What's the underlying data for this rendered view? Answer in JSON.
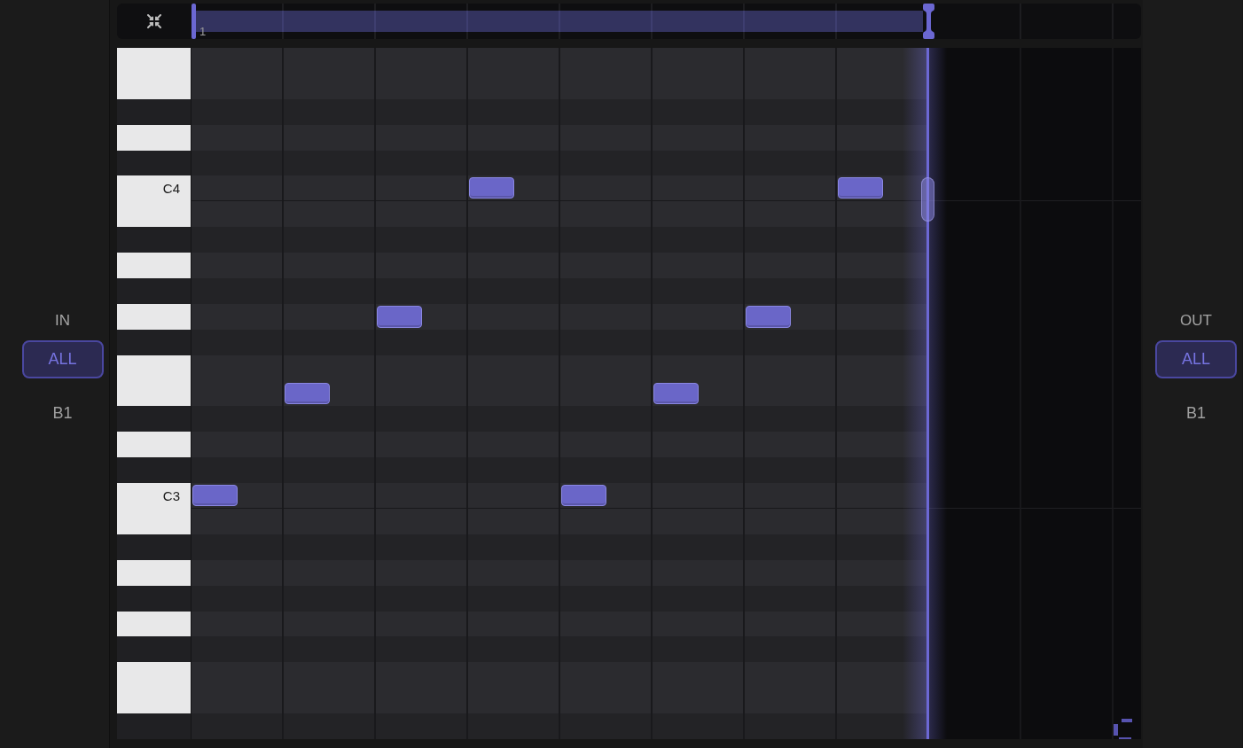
{
  "input": {
    "title": "IN",
    "channel_button": "ALL",
    "note": "B1"
  },
  "ruler": {
    "bar_labels": [
      "1"
    ]
  },
  "piano_roll": {
    "rows": [
      {
        "kind": "white",
        "steps": [
          false,
          false,
          false,
          false,
          false,
          false,
          false,
          false
        ]
      },
      {
        "kind": "white",
        "steps": [
          false,
          false,
          false,
          false,
          false,
          false,
          false,
          false
        ]
      },
      {
        "kind": "black",
        "steps": [
          false,
          false,
          false,
          false,
          false,
          false,
          false,
          false
        ]
      },
      {
        "kind": "white",
        "steps": [
          false,
          false,
          false,
          false,
          false,
          false,
          false,
          false
        ]
      },
      {
        "kind": "black",
        "steps": [
          false,
          false,
          false,
          false,
          false,
          false,
          false,
          false
        ]
      },
      {
        "kind": "white",
        "label": "C4",
        "steps": [
          false,
          false,
          false,
          true,
          false,
          false,
          false,
          true
        ]
      },
      {
        "kind": "white",
        "steps": [
          false,
          false,
          false,
          false,
          false,
          false,
          false,
          false
        ]
      },
      {
        "kind": "black",
        "steps": [
          false,
          false,
          false,
          false,
          false,
          false,
          false,
          false
        ]
      },
      {
        "kind": "white",
        "steps": [
          false,
          false,
          false,
          false,
          false,
          false,
          false,
          false
        ]
      },
      {
        "kind": "black",
        "steps": [
          false,
          false,
          false,
          false,
          false,
          false,
          false,
          false
        ]
      },
      {
        "kind": "white",
        "steps": [
          false,
          false,
          true,
          false,
          false,
          false,
          true,
          false
        ]
      },
      {
        "kind": "black",
        "steps": [
          false,
          false,
          false,
          false,
          false,
          false,
          false,
          false
        ]
      },
      {
        "kind": "white",
        "steps": [
          false,
          false,
          false,
          false,
          false,
          false,
          false,
          false
        ]
      },
      {
        "kind": "white",
        "steps": [
          false,
          true,
          false,
          false,
          false,
          true,
          false,
          false
        ]
      },
      {
        "kind": "black",
        "steps": [
          false,
          false,
          false,
          false,
          false,
          false,
          false,
          false
        ]
      },
      {
        "kind": "white",
        "steps": [
          false,
          false,
          false,
          false,
          false,
          false,
          false,
          false
        ]
      },
      {
        "kind": "black",
        "steps": [
          false,
          false,
          false,
          false,
          false,
          false,
          false,
          false
        ]
      },
      {
        "kind": "white",
        "label": "C3",
        "steps": [
          true,
          false,
          false,
          false,
          true,
          false,
          false,
          false
        ]
      },
      {
        "kind": "white",
        "steps": [
          false,
          false,
          false,
          false,
          false,
          false,
          false,
          false
        ]
      },
      {
        "kind": "black",
        "steps": [
          false,
          false,
          false,
          false,
          false,
          false,
          false,
          false
        ]
      },
      {
        "kind": "white",
        "steps": [
          false,
          false,
          false,
          false,
          false,
          false,
          false,
          false
        ]
      },
      {
        "kind": "black",
        "steps": [
          false,
          false,
          false,
          false,
          false,
          false,
          false,
          false
        ]
      },
      {
        "kind": "white",
        "steps": [
          false,
          false,
          false,
          false,
          false,
          false,
          false,
          false
        ]
      },
      {
        "kind": "black",
        "steps": [
          false,
          false,
          false,
          false,
          false,
          false,
          false,
          false
        ]
      },
      {
        "kind": "white",
        "steps": [
          false,
          false,
          false,
          false,
          false,
          false,
          false,
          false
        ]
      },
      {
        "kind": "white",
        "steps": [
          false,
          false,
          false,
          false,
          false,
          false,
          false,
          false
        ]
      },
      {
        "kind": "black",
        "steps": [
          false,
          false,
          false,
          false,
          false,
          false,
          false,
          false
        ]
      }
    ]
  },
  "output": {
    "title": "OUT",
    "channel_button": "ALL",
    "note": "B1"
  }
}
